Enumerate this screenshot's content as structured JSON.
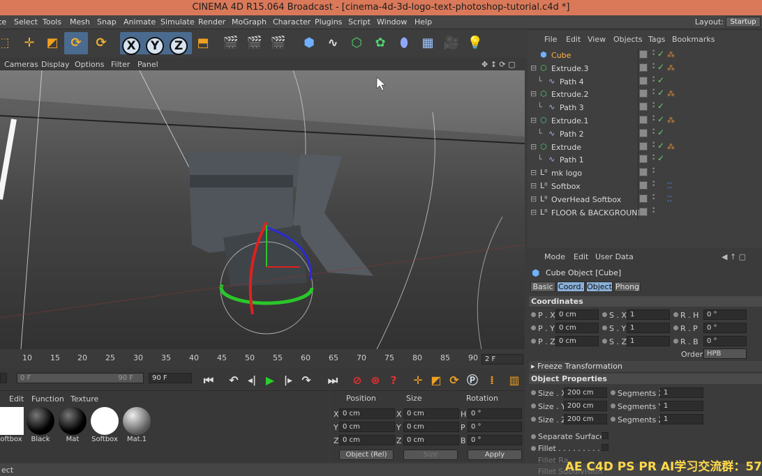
{
  "window": {
    "title": "CINEMA 4D R15.064 Broadcast - [cinema-4d-3d-logo-text-photoshop-tutorial.c4d *]"
  },
  "menubar": {
    "items": [
      "te",
      "Select",
      "Tools",
      "Mesh",
      "Snap",
      "Animate",
      "Simulate",
      "Render",
      "MoGraph",
      "Character",
      "Plugins",
      "Script",
      "Window",
      "Help"
    ],
    "layout_label": "Layout:",
    "layout_value": "Startup"
  },
  "viewport": {
    "menu": [
      "Cameras",
      "Display",
      "Options",
      "Filter",
      "Panel"
    ]
  },
  "timeline": {
    "ticks": [
      "10",
      "15",
      "20",
      "25",
      "30",
      "35",
      "40",
      "45",
      "50",
      "55",
      "60",
      "65",
      "70",
      "75",
      "80",
      "85",
      "90"
    ],
    "current_frame": "2 F",
    "start_field": "0 F",
    "end_field": "90 F",
    "max_field": "90 F"
  },
  "material_panel": {
    "menu": [
      "Edit",
      "Function",
      "Texture"
    ],
    "materials": [
      "oftbox",
      "Black",
      "Mat",
      "Softbox",
      "Mat.1"
    ]
  },
  "coord_panel": {
    "headers": {
      "position": "Position",
      "size": "Size",
      "rotation": "Rotation"
    },
    "rows": [
      {
        "a": "X",
        "pos": "0 cm",
        "b": "X",
        "size": "0 cm",
        "c": "H",
        "rot": "0 °"
      },
      {
        "a": "Y",
        "pos": "0 cm",
        "b": "Y",
        "size": "0 cm",
        "c": "P",
        "rot": "0 °"
      },
      {
        "a": "Z",
        "pos": "0 cm",
        "b": "Z",
        "size": "0 cm",
        "c": "B",
        "rot": "0 °"
      }
    ],
    "mode": "Object (Rel)",
    "size_mode": "Size",
    "apply": "Apply"
  },
  "object_manager": {
    "menu": [
      "File",
      "Edit",
      "View",
      "Objects",
      "Tags",
      "Bookmarks"
    ],
    "rows": [
      {
        "name": "Cube",
        "indent": 0,
        "type": "cube",
        "selected": true,
        "check": true,
        "tag": true
      },
      {
        "name": "Extrude.3",
        "indent": 0,
        "type": "extrude",
        "check": true,
        "tag": true
      },
      {
        "name": "Path 4",
        "indent": 1,
        "type": "path",
        "check": true
      },
      {
        "name": "Extrude.2",
        "indent": 0,
        "type": "extrude",
        "check": true,
        "tag": true
      },
      {
        "name": "Path 3",
        "indent": 1,
        "type": "path",
        "check": true
      },
      {
        "name": "Extrude.1",
        "indent": 0,
        "type": "extrude",
        "check": true,
        "tag": true
      },
      {
        "name": "Path 2",
        "indent": 1,
        "type": "path",
        "check": true
      },
      {
        "name": "Extrude",
        "indent": 0,
        "type": "extrude",
        "check": true,
        "tag": true
      },
      {
        "name": "Path 1",
        "indent": 1,
        "type": "path",
        "check": true
      },
      {
        "name": "mk logo",
        "indent": 0,
        "type": "null"
      },
      {
        "name": "Softbox",
        "indent": 0,
        "type": "null",
        "light": true
      },
      {
        "name": "OverHead Softbox",
        "indent": 0,
        "type": "null",
        "light": true
      },
      {
        "name": "FLOOR & BACKGROUND",
        "indent": 0,
        "type": "null"
      }
    ]
  },
  "attributes": {
    "menu": [
      "Mode",
      "Edit",
      "User Data"
    ],
    "object_title": "Cube Object [Cube]",
    "tabs": [
      "Basic",
      "Coord.",
      "Object",
      "Phong"
    ],
    "coordinates_title": "Coordinates",
    "coords": [
      {
        "l1": "P . X",
        "v1": "0 cm",
        "l2": "S . X",
        "v2": "1",
        "l3": "R . H",
        "v3": "0 °"
      },
      {
        "l1": "P . Y",
        "v1": "0 cm",
        "l2": "S . Y",
        "v2": "1",
        "l3": "R . P",
        "v3": "0 °"
      },
      {
        "l1": "P . Z",
        "v1": "0 cm",
        "l2": "S . Z",
        "v2": "1",
        "l3": "R . B",
        "v3": "0 °"
      }
    ],
    "order_label": "Order",
    "order_value": "HPB",
    "freeze": "Freeze Transformation",
    "object_props_title": "Object Properties",
    "props": [
      {
        "l1": "Size . X",
        "v1": "200 cm",
        "l2": "Segments X",
        "v2": "1"
      },
      {
        "l1": "Size . Y",
        "v1": "200 cm",
        "l2": "Segments Y",
        "v2": "1"
      },
      {
        "l1": "Size . Z",
        "v1": "200 cm",
        "l2": "Segments Z",
        "v2": "1"
      }
    ],
    "separate_surfaces": "Separate Surfaces",
    "fillet": "Fillet . . . . . . . . . .",
    "fillet_radius": "Fillet Ra",
    "fillet_subdivision": "Fillet Subdivision"
  },
  "status": {
    "text": "ect"
  },
  "watermark": {
    "text": "AE C4D PS PR AI学习交流群：57"
  }
}
